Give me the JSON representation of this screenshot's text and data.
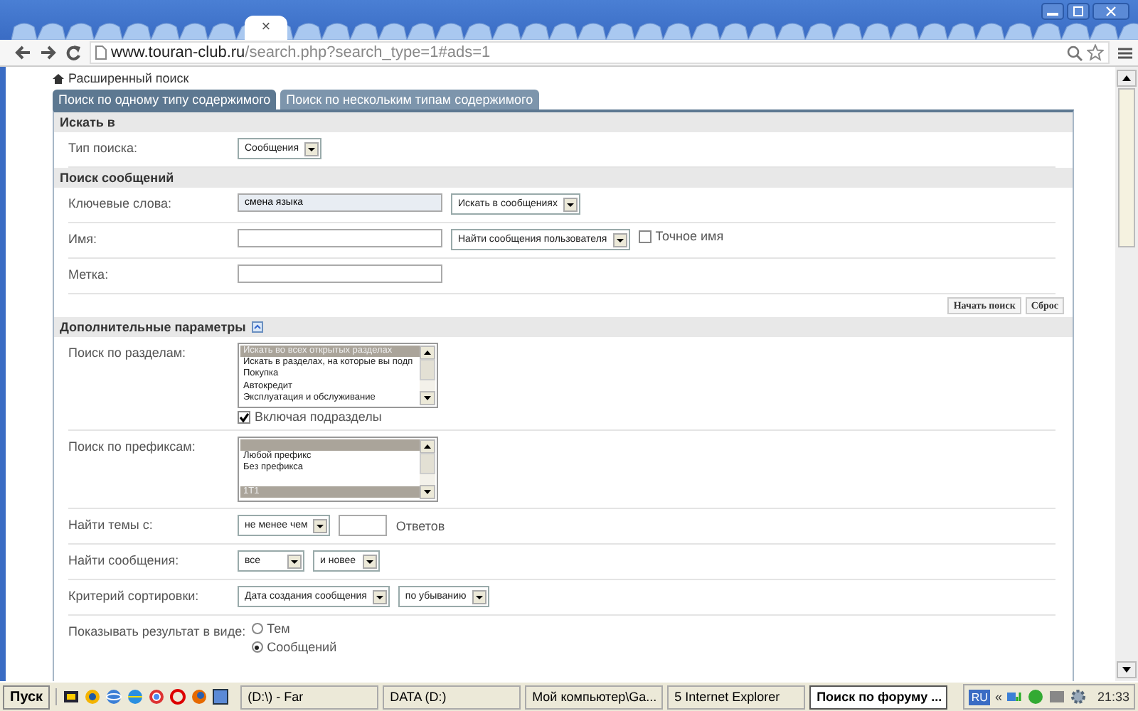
{
  "browser": {
    "tab_close": "×",
    "url_host": "www.touran-club.ru",
    "url_path": "/search.php?search_type=1#ads=1"
  },
  "breadcrumb": "Расширенный поиск",
  "tabs": [
    {
      "label": "Поиск по одному типу содержимого",
      "selected": true
    },
    {
      "label": "Поиск по нескольким типам содержимого",
      "selected": false
    }
  ],
  "sections": [
    {
      "title": "Искать в",
      "toggle": false,
      "rows": [
        {
          "label": "Тип поиска:",
          "controls": [
            {
              "kind": "select",
              "value": "Сообщения"
            }
          ]
        }
      ]
    },
    {
      "title": "Поиск сообщений",
      "toggle": false,
      "rows": [
        {
          "label": "Ключевые слова:",
          "controls": [
            {
              "kind": "text",
              "value": "смена языка"
            },
            {
              "kind": "select",
              "value": "Искать в сообщениях"
            }
          ]
        },
        {
          "label": "Имя:",
          "controls": [
            {
              "kind": "text"
            },
            {
              "kind": "select",
              "value": "Найти сообщения пользователя"
            },
            {
              "kind": "checkbox",
              "label": "Точное имя",
              "checked": false
            }
          ]
        },
        {
          "label": "Метка:",
          "controls": [
            {
              "kind": "text"
            }
          ]
        }
      ],
      "actions": [
        "Начать поиск",
        "Сброс"
      ]
    },
    {
      "title": "Дополнительные параметры",
      "toggle": true,
      "rows": [
        {
          "label": "Поиск по разделам:",
          "controls": [
            {
              "kind": "listbox",
              "items": [
                {
                  "label": "Искать во всех открытых разделах",
                  "selected": true
                },
                {
                  "label": "Искать в разделах, на которые вы подп",
                  "selected": false
                },
                {
                  "label": "Покупка",
                  "selected": false
                },
                {
                  "label": "Автокредит",
                  "selected": false
                },
                {
                  "label": "Эксплуатация и обслуживание",
                  "selected": false
                }
              ]
            },
            {
              "kind": "checkbox",
              "label": "Включая подразделы",
              "checked": true
            }
          ]
        },
        {
          "label": "Поиск по префиксам:",
          "controls": [
            {
              "kind": "listbox",
              "items": [
                {
                  "selected": true
                },
                {
                  "label": "Любой префикс",
                  "selected": false
                },
                {
                  "label": "Без префикса",
                  "selected": false
                },
                {
                  "selected": false
                },
                {
                  "label": "1T1",
                  "selected": true
                }
              ]
            }
          ]
        },
        {
          "label": "Найти темы с:",
          "controls": [
            {
              "kind": "select",
              "value": "не менее чем"
            },
            {
              "kind": "number"
            },
            {
              "kind": "note",
              "label": "Ответов"
            }
          ]
        },
        {
          "label": "Найти сообщения:",
          "controls": [
            {
              "kind": "select",
              "value": "все"
            },
            {
              "kind": "select",
              "value": "и новее"
            }
          ]
        },
        {
          "label": "Критерий сортировки:",
          "controls": [
            {
              "kind": "select",
              "value": "Дата создания сообщения"
            },
            {
              "kind": "select",
              "value": "по убыванию"
            }
          ]
        },
        {
          "label": "Показывать результат в виде:",
          "controls": [
            {
              "kind": "radio",
              "options": [
                {
                  "label": "Тем",
                  "selected": false
                },
                {
                  "label": "Сообщений",
                  "selected": true
                }
              ]
            }
          ]
        }
      ]
    }
  ],
  "taskbar": {
    "start": "Пуск",
    "tasks": [
      {
        "label": "(D:\\) - Far",
        "selected": false
      },
      {
        "label": "DATA (D:)",
        "selected": false
      },
      {
        "label": "Мой компьютер\\Ga...",
        "selected": false
      },
      {
        "label": "5 Internet Explorer",
        "selected": false
      },
      {
        "label": "Поиск по форуму ...",
        "selected": true
      }
    ],
    "language": "RU",
    "tray_expand": "«",
    "clock": "21:33"
  }
}
